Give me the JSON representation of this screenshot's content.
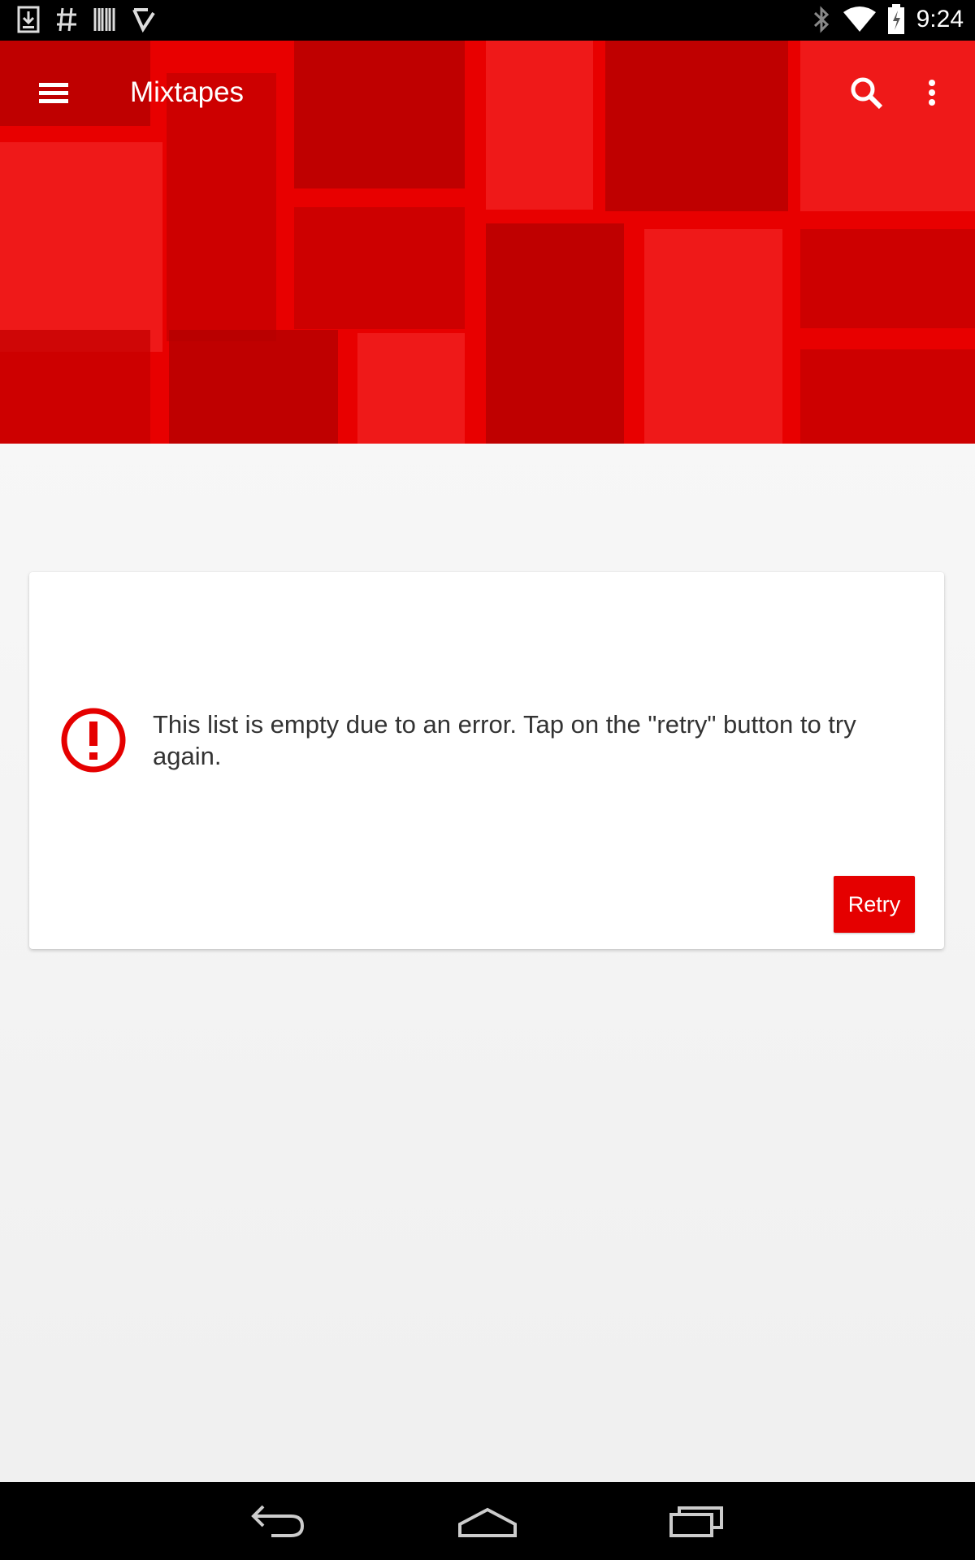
{
  "status_bar": {
    "time": "9:24",
    "left_icons": [
      "download-icon",
      "hash-icon",
      "barcode-icon",
      "check-icon"
    ],
    "right_icons": [
      "bluetooth-icon",
      "wifi-icon",
      "battery-icon"
    ]
  },
  "app_bar": {
    "title": "Mixtapes",
    "icons": [
      "menu-icon",
      "search-icon",
      "more-vert-icon"
    ]
  },
  "error_card": {
    "message": "This list is empty due to an error. Tap on the \"retry\" button to try again.",
    "retry_label": "Retry",
    "icon": "error-icon"
  },
  "nav_bar": {
    "icons": [
      "back-icon",
      "home-icon",
      "recents-icon"
    ]
  },
  "colors": {
    "accent": "#e50000",
    "status_bar": "#000000",
    "background": "#f5f5f5"
  }
}
